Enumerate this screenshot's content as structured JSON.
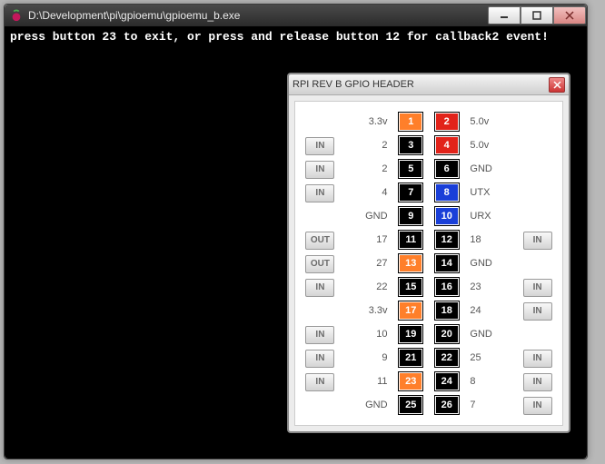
{
  "window": {
    "title": "D:\\Development\\pi\\gpioemu\\gpioemu_b.exe",
    "console_text": "press button 23 to exit, or press and release button 12 for callback2 event!"
  },
  "gpio": {
    "title": "RPI REV B GPIO HEADER",
    "rows": [
      {
        "left_btn": "",
        "left_label": "3.3v",
        "pin_l": {
          "n": "1",
          "c": "orange"
        },
        "pin_r": {
          "n": "2",
          "c": "red"
        },
        "right_label": "5.0v",
        "right_btn": ""
      },
      {
        "left_btn": "IN",
        "left_label": "2",
        "pin_l": {
          "n": "3",
          "c": "black"
        },
        "pin_r": {
          "n": "4",
          "c": "red"
        },
        "right_label": "5.0v",
        "right_btn": ""
      },
      {
        "left_btn": "IN",
        "left_label": "2",
        "pin_l": {
          "n": "5",
          "c": "black"
        },
        "pin_r": {
          "n": "6",
          "c": "black"
        },
        "right_label": "GND",
        "right_btn": ""
      },
      {
        "left_btn": "IN",
        "left_label": "4",
        "pin_l": {
          "n": "7",
          "c": "black"
        },
        "pin_r": {
          "n": "8",
          "c": "blue"
        },
        "right_label": "UTX",
        "right_btn": ""
      },
      {
        "left_btn": "",
        "left_label": "GND",
        "pin_l": {
          "n": "9",
          "c": "black"
        },
        "pin_r": {
          "n": "10",
          "c": "blue"
        },
        "right_label": "URX",
        "right_btn": ""
      },
      {
        "left_btn": "OUT",
        "left_label": "17",
        "pin_l": {
          "n": "11",
          "c": "black"
        },
        "pin_r": {
          "n": "12",
          "c": "black"
        },
        "right_label": "18",
        "right_btn": "IN"
      },
      {
        "left_btn": "OUT",
        "left_label": "27",
        "pin_l": {
          "n": "13",
          "c": "orange"
        },
        "pin_r": {
          "n": "14",
          "c": "black"
        },
        "right_label": "GND",
        "right_btn": ""
      },
      {
        "left_btn": "IN",
        "left_label": "22",
        "pin_l": {
          "n": "15",
          "c": "black"
        },
        "pin_r": {
          "n": "16",
          "c": "black"
        },
        "right_label": "23",
        "right_btn": "IN"
      },
      {
        "left_btn": "",
        "left_label": "3.3v",
        "pin_l": {
          "n": "17",
          "c": "orange"
        },
        "pin_r": {
          "n": "18",
          "c": "black"
        },
        "right_label": "24",
        "right_btn": "IN"
      },
      {
        "left_btn": "IN",
        "left_label": "10",
        "pin_l": {
          "n": "19",
          "c": "black"
        },
        "pin_r": {
          "n": "20",
          "c": "black"
        },
        "right_label": "GND",
        "right_btn": ""
      },
      {
        "left_btn": "IN",
        "left_label": "9",
        "pin_l": {
          "n": "21",
          "c": "black"
        },
        "pin_r": {
          "n": "22",
          "c": "black"
        },
        "right_label": "25",
        "right_btn": "IN"
      },
      {
        "left_btn": "IN",
        "left_label": "11",
        "pin_l": {
          "n": "23",
          "c": "orange"
        },
        "pin_r": {
          "n": "24",
          "c": "black"
        },
        "right_label": "8",
        "right_btn": "IN"
      },
      {
        "left_btn": "",
        "left_label": "GND",
        "pin_l": {
          "n": "25",
          "c": "black"
        },
        "pin_r": {
          "n": "26",
          "c": "black"
        },
        "right_label": "7",
        "right_btn": "IN"
      }
    ]
  }
}
